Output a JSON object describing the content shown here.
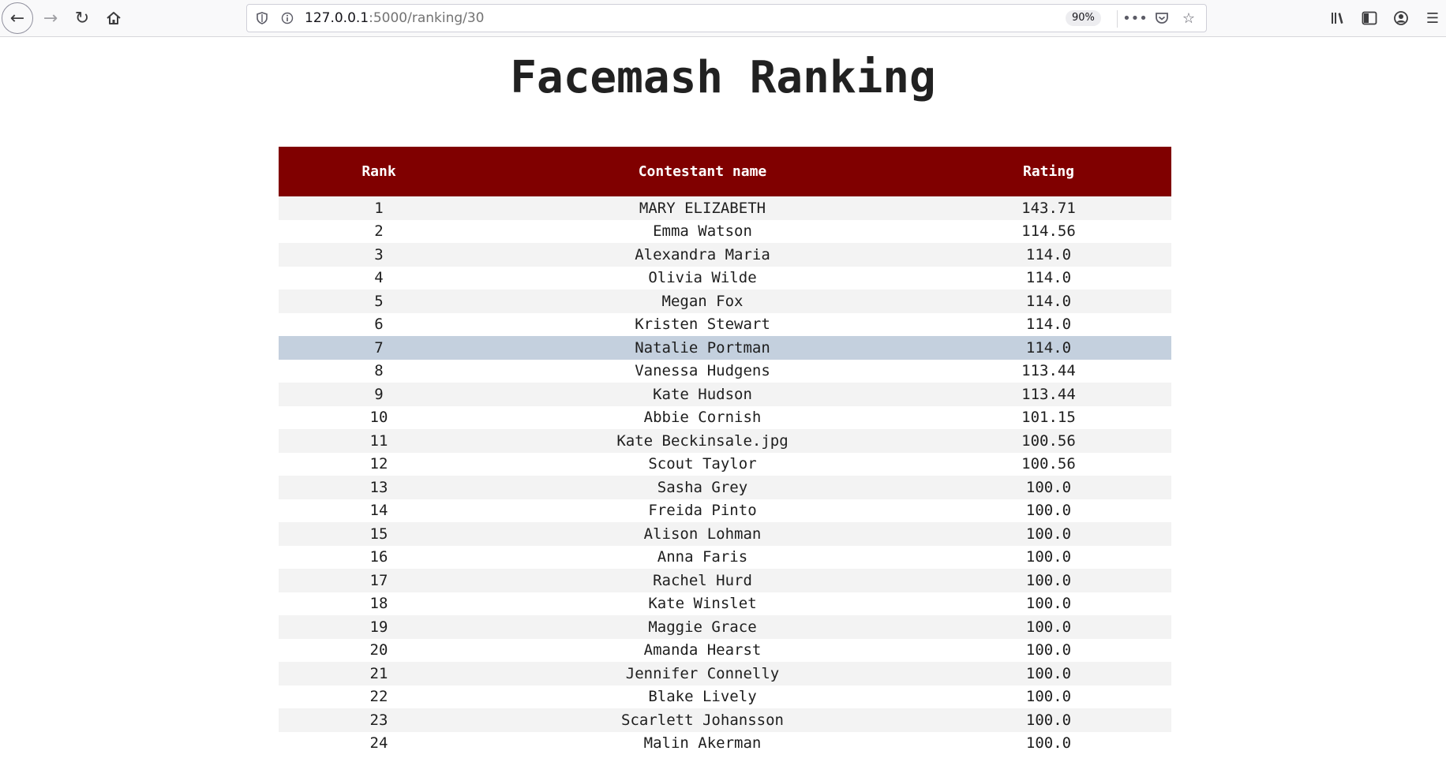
{
  "browser": {
    "url_host": "127.0.0.1",
    "url_path": ":5000/ranking/30",
    "zoom": "90%"
  },
  "page": {
    "title": "Facemash Ranking"
  },
  "table": {
    "headers": {
      "rank": "Rank",
      "name": "Contestant name",
      "rating": "Rating"
    },
    "highlighted_rank": "7",
    "rows": [
      {
        "rank": "1",
        "name": "MARY ELIZABETH",
        "rating": "143.71"
      },
      {
        "rank": "2",
        "name": "Emma Watson",
        "rating": "114.56"
      },
      {
        "rank": "3",
        "name": "Alexandra Maria",
        "rating": "114.0"
      },
      {
        "rank": "4",
        "name": "Olivia Wilde",
        "rating": "114.0"
      },
      {
        "rank": "5",
        "name": "Megan Fox",
        "rating": "114.0"
      },
      {
        "rank": "6",
        "name": "Kristen Stewart",
        "rating": "114.0"
      },
      {
        "rank": "7",
        "name": "Natalie Portman",
        "rating": "114.0"
      },
      {
        "rank": "8",
        "name": "Vanessa Hudgens",
        "rating": "113.44"
      },
      {
        "rank": "9",
        "name": "Kate Hudson",
        "rating": "113.44"
      },
      {
        "rank": "10",
        "name": "Abbie Cornish",
        "rating": "101.15"
      },
      {
        "rank": "11",
        "name": "Kate Beckinsale.jpg",
        "rating": "100.56"
      },
      {
        "rank": "12",
        "name": "Scout Taylor",
        "rating": "100.56"
      },
      {
        "rank": "13",
        "name": "Sasha Grey",
        "rating": "100.0"
      },
      {
        "rank": "14",
        "name": "Freida Pinto",
        "rating": "100.0"
      },
      {
        "rank": "15",
        "name": "Alison Lohman",
        "rating": "100.0"
      },
      {
        "rank": "16",
        "name": "Anna Faris",
        "rating": "100.0"
      },
      {
        "rank": "17",
        "name": "Rachel Hurd",
        "rating": "100.0"
      },
      {
        "rank": "18",
        "name": "Kate Winslet",
        "rating": "100.0"
      },
      {
        "rank": "19",
        "name": "Maggie Grace",
        "rating": "100.0"
      },
      {
        "rank": "20",
        "name": "Amanda Hearst",
        "rating": "100.0"
      },
      {
        "rank": "21",
        "name": "Jennifer Connelly",
        "rating": "100.0"
      },
      {
        "rank": "22",
        "name": "Blake Lively",
        "rating": "100.0"
      },
      {
        "rank": "23",
        "name": "Scarlett Johansson",
        "rating": "100.0"
      },
      {
        "rank": "24",
        "name": "Malin Akerman",
        "rating": "100.0"
      }
    ]
  }
}
